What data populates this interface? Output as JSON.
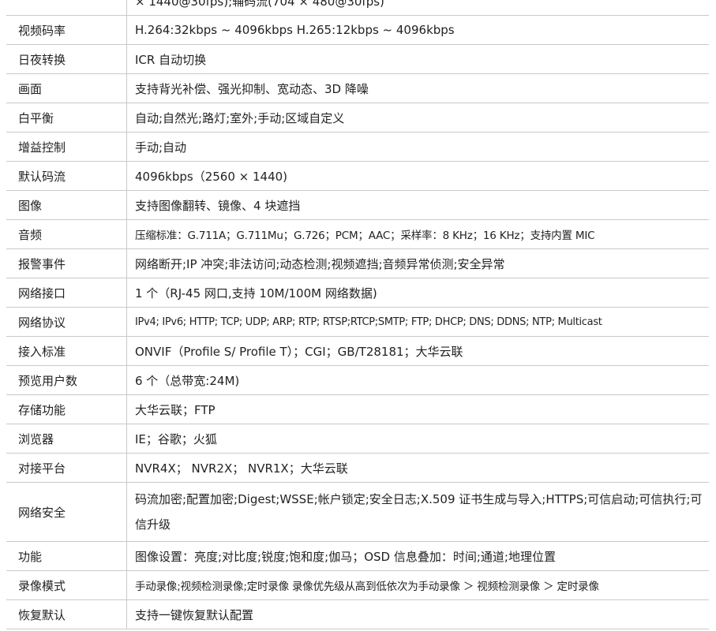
{
  "partial_top_row": {
    "value": "× 1440@30fps);辅码流(704 × 480@30fps)"
  },
  "rows": [
    {
      "label": "视频码率",
      "value": "H.264:32kbps ~ 4096kbps    H.265:12kbps ~ 4096kbps"
    },
    {
      "label": "日夜转换",
      "value": "ICR 自动切换"
    },
    {
      "label": "画面",
      "value": "支持背光补偿、强光抑制、宽动态、3D 降噪"
    },
    {
      "label": "白平衡",
      "value": "自动;自然光;路灯;室外;手动;区域自定义"
    },
    {
      "label": "增益控制",
      "value": "手动;自动"
    },
    {
      "label": "默认码流",
      "value": "4096kbps（2560 × 1440)"
    },
    {
      "label": "图像",
      "value": "支持图像翻转、镜像、4 块遮挡"
    },
    {
      "label": "音频",
      "value": "压缩标准：G.711A；G.711Mu；G.726；PCM；AAC；采样率：8 KHz；16 KHz；支持内置 MIC"
    },
    {
      "label": "报警事件",
      "value": "网络断开;IP 冲突;非法访问;动态检测;视频遮挡;音频异常侦测;安全异常"
    },
    {
      "label": "网络接口",
      "value": "1 个（RJ-45 网口,支持 10M/100M  网络数据)"
    },
    {
      "label": "网络协议",
      "value": "IPv4; IPv6; HTTP; TCP; UDP; ARP; RTP; RTSP;RTCP;SMTP; FTP; DHCP; DNS; DDNS; NTP; Multicast"
    },
    {
      "label": "接入标准",
      "value": "ONVIF（Profile S/ Profile T）；CGI；GB/T28181；大华云联"
    },
    {
      "label": "预览用户数",
      "value": "6 个（总带宽:24M)"
    },
    {
      "label": "存储功能",
      "value": "大华云联；FTP"
    },
    {
      "label": "浏览器",
      "value": "IE；谷歌；火狐"
    },
    {
      "label": "对接平台",
      "value": "NVR4X；  NVR2X；  NVR1X；大华云联"
    },
    {
      "label": "网络安全",
      "value": "码流加密;配置加密;Digest;WSSE;帐户锁定;安全日志;X.509 证书生成与导入;HTTPS;可信启动;可信执行;可信升级"
    },
    {
      "label": "功能",
      "value": "图像设置：亮度;对比度;锐度;饱和度;伽马；OSD 信息叠加：时间;通道;地理位置"
    },
    {
      "label": "录像模式",
      "value": "手动录像;视频检测录像;定时录像    录像优先级从高到低依次为手动录像 ＞ 视频检测录像 ＞ 定时录像"
    },
    {
      "label": "恢复默认",
      "value": "支持一键恢复默认配置"
    }
  ]
}
